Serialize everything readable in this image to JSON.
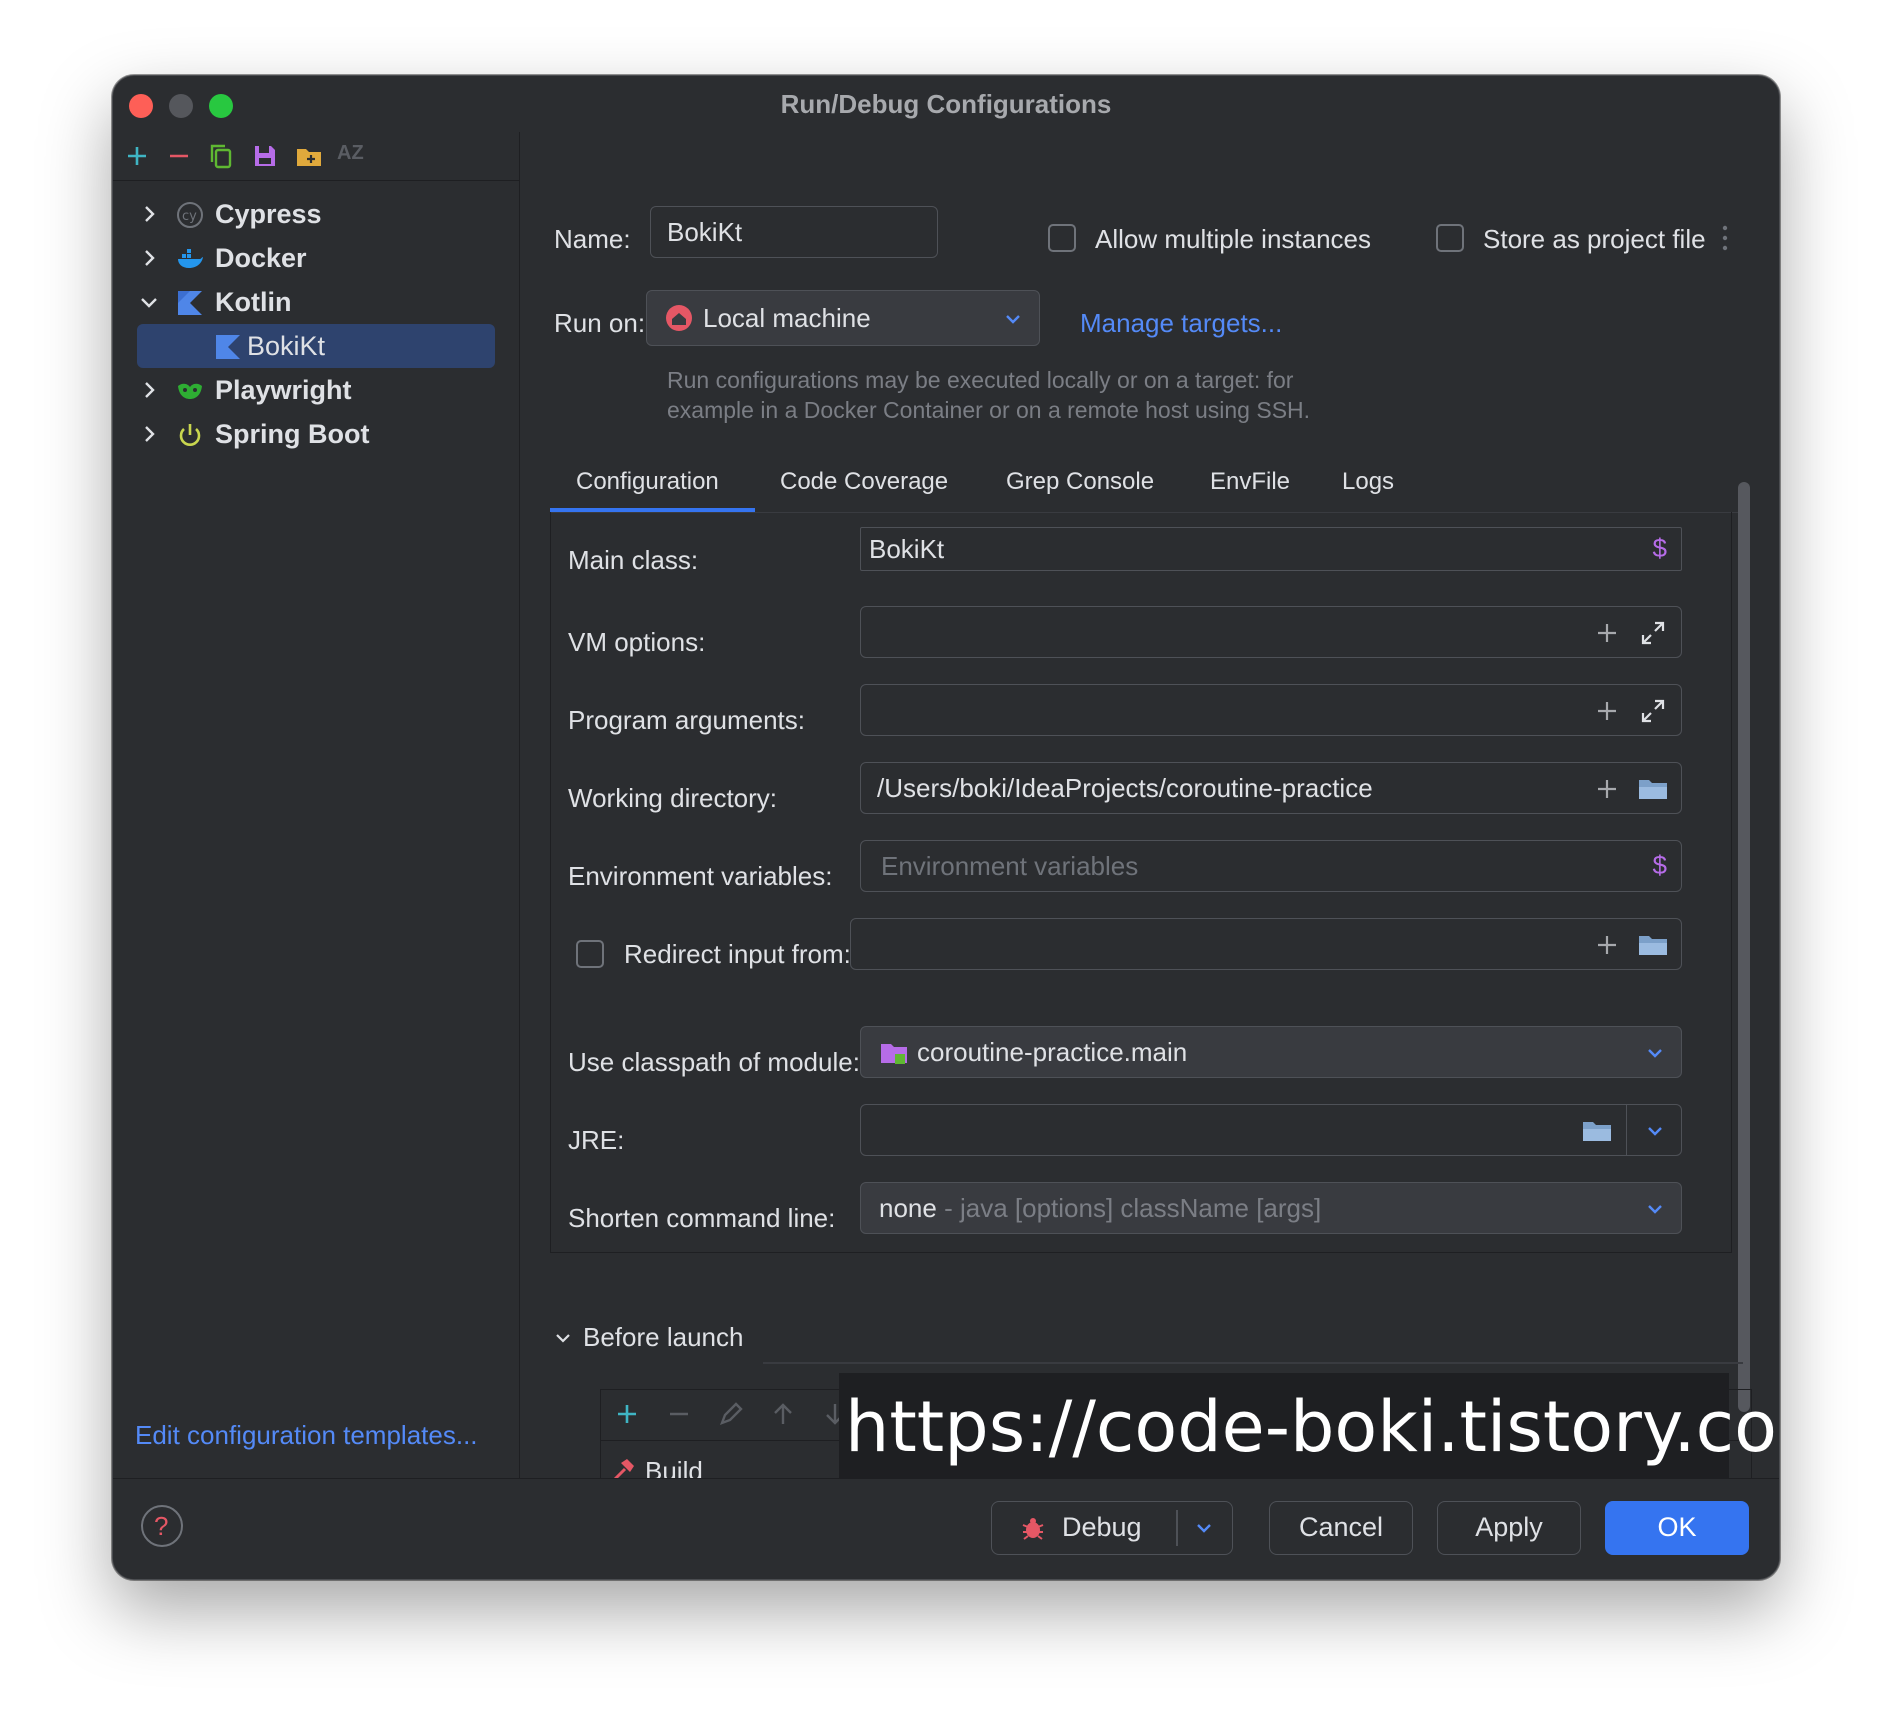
{
  "window": {
    "title": "Run/Debug Configurations"
  },
  "toolbar": {
    "icons": [
      "add-icon",
      "remove-icon",
      "copy-icon",
      "save-icon",
      "folder-add-icon",
      "sort-az-icon"
    ],
    "sort_label": "AZ"
  },
  "tree": {
    "items": [
      {
        "label": "Cypress",
        "icon": "cypress-icon",
        "expanded": false
      },
      {
        "label": "Docker",
        "icon": "docker-icon",
        "expanded": false
      },
      {
        "label": "Kotlin",
        "icon": "kotlin-icon",
        "expanded": true
      },
      {
        "label": "BokiKt",
        "icon": "kotlin-file-icon",
        "selected": true
      },
      {
        "label": "Playwright",
        "icon": "playwright-icon",
        "expanded": false
      },
      {
        "label": "Spring Boot",
        "icon": "spring-boot-icon",
        "expanded": false
      }
    ],
    "edit_templates": "Edit configuration templates..."
  },
  "form": {
    "name_label": "Name:",
    "name_value": "BokiKt",
    "allow_multiple": "Allow multiple instances",
    "store_as_project": "Store as project file",
    "run_on_label": "Run on:",
    "run_on_value": "Local machine",
    "manage_targets": "Manage targets...",
    "hint_line1": "Run configurations may be executed locally or on a target: for",
    "hint_line2": "example in a Docker Container or on a remote host using SSH."
  },
  "tabs": [
    "Configuration",
    "Code Coverage",
    "Grep Console",
    "EnvFile",
    "Logs"
  ],
  "config": {
    "main_class_label": "Main class:",
    "main_class_value": "BokiKt",
    "vm_options_label": "VM options:",
    "program_args_label": "Program arguments:",
    "working_dir_label": "Working directory:",
    "working_dir_value": "/Users/boki/IdeaProjects/coroutine-practice",
    "env_vars_label": "Environment variables:",
    "env_vars_placeholder": "Environment variables",
    "redirect_label": "Redirect input from:",
    "classpath_label": "Use classpath of module:",
    "classpath_value": "coroutine-practice.main",
    "jre_label": "JRE:",
    "shorten_label": "Shorten command line:",
    "shorten_value": "none",
    "shorten_detail": "- java [options] className [args]"
  },
  "before_launch": {
    "title": "Before launch",
    "task": "Build"
  },
  "watermark": "https://code-boki.tistory.com",
  "footer": {
    "debug": "Debug",
    "cancel": "Cancel",
    "apply": "Apply",
    "ok": "OK"
  },
  "colors": {
    "accent": "#3574f0",
    "link": "#548af7",
    "background": "#2b2d30"
  }
}
